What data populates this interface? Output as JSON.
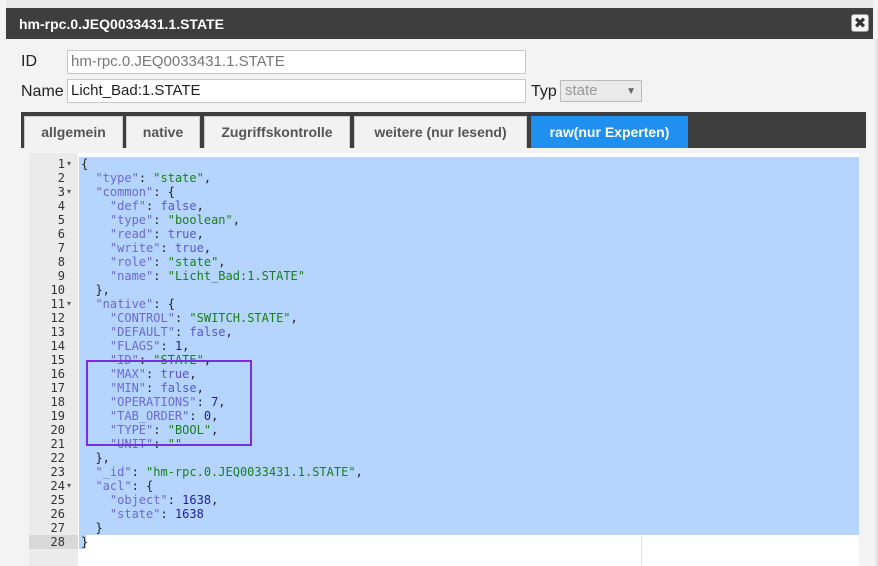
{
  "dialog": {
    "title": "hm-rpc.0.JEQ0033431.1.STATE",
    "close_glyph": "✖"
  },
  "form": {
    "id_label": "ID",
    "id_value": "hm-rpc.0.JEQ0033431.1.STATE",
    "name_label": "Name",
    "name_value": "Licht_Bad:1.STATE",
    "type_label": "Typ",
    "type_value": "state"
  },
  "tabs": [
    {
      "label": "allgemein"
    },
    {
      "label": "native"
    },
    {
      "label": "Zugriffskontrolle"
    },
    {
      "label": "weitere (nur lesend)"
    },
    {
      "label": "raw(nur Experten)",
      "active": true
    }
  ],
  "editor": {
    "line_numbers": [
      "1",
      "2",
      "3",
      "4",
      "5",
      "6",
      "7",
      "8",
      "9",
      "10",
      "11",
      "12",
      "13",
      "14",
      "15",
      "16",
      "17",
      "18",
      "19",
      "20",
      "21",
      "22",
      "23",
      "24",
      "25",
      "26",
      "27",
      "28"
    ],
    "fold_lines": [
      1,
      3,
      11,
      24
    ],
    "lines": [
      [
        [
          "p",
          "{"
        ]
      ],
      [
        [
          "p",
          "  "
        ],
        [
          "k",
          "\"type\""
        ],
        [
          "p",
          ": "
        ],
        [
          "s",
          "\"state\""
        ],
        [
          "p",
          ","
        ]
      ],
      [
        [
          "p",
          "  "
        ],
        [
          "k",
          "\"common\""
        ],
        [
          "p",
          ": {"
        ]
      ],
      [
        [
          "p",
          "    "
        ],
        [
          "k",
          "\"def\""
        ],
        [
          "p",
          ": "
        ],
        [
          "b",
          "false"
        ],
        [
          "p",
          ","
        ]
      ],
      [
        [
          "p",
          "    "
        ],
        [
          "k",
          "\"type\""
        ],
        [
          "p",
          ": "
        ],
        [
          "s",
          "\"boolean\""
        ],
        [
          "p",
          ","
        ]
      ],
      [
        [
          "p",
          "    "
        ],
        [
          "k",
          "\"read\""
        ],
        [
          "p",
          ": "
        ],
        [
          "b",
          "true"
        ],
        [
          "p",
          ","
        ]
      ],
      [
        [
          "p",
          "    "
        ],
        [
          "k",
          "\"write\""
        ],
        [
          "p",
          ": "
        ],
        [
          "b",
          "true"
        ],
        [
          "p",
          ","
        ]
      ],
      [
        [
          "p",
          "    "
        ],
        [
          "k",
          "\"role\""
        ],
        [
          "p",
          ": "
        ],
        [
          "s",
          "\"state\""
        ],
        [
          "p",
          ","
        ]
      ],
      [
        [
          "p",
          "    "
        ],
        [
          "k",
          "\"name\""
        ],
        [
          "p",
          ": "
        ],
        [
          "s",
          "\"Licht_Bad:1.STATE\""
        ]
      ],
      [
        [
          "p",
          "  },"
        ]
      ],
      [
        [
          "p",
          "  "
        ],
        [
          "k",
          "\"native\""
        ],
        [
          "p",
          ": {"
        ]
      ],
      [
        [
          "p",
          "    "
        ],
        [
          "k",
          "\"CONTROL\""
        ],
        [
          "p",
          ": "
        ],
        [
          "s",
          "\"SWITCH.STATE\""
        ],
        [
          "p",
          ","
        ]
      ],
      [
        [
          "p",
          "    "
        ],
        [
          "k",
          "\"DEFAULT\""
        ],
        [
          "p",
          ": "
        ],
        [
          "b",
          "false"
        ],
        [
          "p",
          ","
        ]
      ],
      [
        [
          "p",
          "    "
        ],
        [
          "k",
          "\"FLAGS\""
        ],
        [
          "p",
          ": "
        ],
        [
          "n",
          "1"
        ],
        [
          "p",
          ","
        ]
      ],
      [
        [
          "p",
          "    "
        ],
        [
          "k",
          "\"ID\""
        ],
        [
          "p",
          ": "
        ],
        [
          "s",
          "\"STATE\""
        ],
        [
          "p",
          ","
        ]
      ],
      [
        [
          "p",
          "    "
        ],
        [
          "k",
          "\"MAX\""
        ],
        [
          "p",
          ": "
        ],
        [
          "b",
          "true"
        ],
        [
          "p",
          ","
        ]
      ],
      [
        [
          "p",
          "    "
        ],
        [
          "k",
          "\"MIN\""
        ],
        [
          "p",
          ": "
        ],
        [
          "b",
          "false"
        ],
        [
          "p",
          ","
        ]
      ],
      [
        [
          "p",
          "    "
        ],
        [
          "k",
          "\"OPERATIONS\""
        ],
        [
          "p",
          ": "
        ],
        [
          "n",
          "7"
        ],
        [
          "p",
          ","
        ]
      ],
      [
        [
          "p",
          "    "
        ],
        [
          "k",
          "\"TAB_ORDER\""
        ],
        [
          "p",
          ": "
        ],
        [
          "n",
          "0"
        ],
        [
          "p",
          ","
        ]
      ],
      [
        [
          "p",
          "    "
        ],
        [
          "k",
          "\"TYPE\""
        ],
        [
          "p",
          ": "
        ],
        [
          "s",
          "\"BOOL\""
        ],
        [
          "p",
          ","
        ]
      ],
      [
        [
          "p",
          "    "
        ],
        [
          "k",
          "\"UNIT\""
        ],
        [
          "p",
          ": "
        ],
        [
          "s",
          "\"\""
        ]
      ],
      [
        [
          "p",
          "  },"
        ]
      ],
      [
        [
          "p",
          "  "
        ],
        [
          "k",
          "\"_id\""
        ],
        [
          "p",
          ": "
        ],
        [
          "s",
          "\"hm-rpc.0.JEQ0033431.1.STATE\""
        ],
        [
          "p",
          ","
        ]
      ],
      [
        [
          "p",
          "  "
        ],
        [
          "k",
          "\"acl\""
        ],
        [
          "p",
          ": {"
        ]
      ],
      [
        [
          "p",
          "    "
        ],
        [
          "k",
          "\"object\""
        ],
        [
          "p",
          ": "
        ],
        [
          "n",
          "1638"
        ],
        [
          "p",
          ","
        ]
      ],
      [
        [
          "p",
          "    "
        ],
        [
          "k",
          "\"state\""
        ],
        [
          "p",
          ": "
        ],
        [
          "n",
          "1638"
        ]
      ],
      [
        [
          "p",
          "  }"
        ]
      ],
      [
        [
          "p",
          "}"
        ]
      ]
    ]
  },
  "colors": {
    "titlebar": "#3e3e3e",
    "active_tab": "#1f8ff0",
    "selection": "#b5d5ff",
    "highlight_box": "#7a2ee0"
  }
}
